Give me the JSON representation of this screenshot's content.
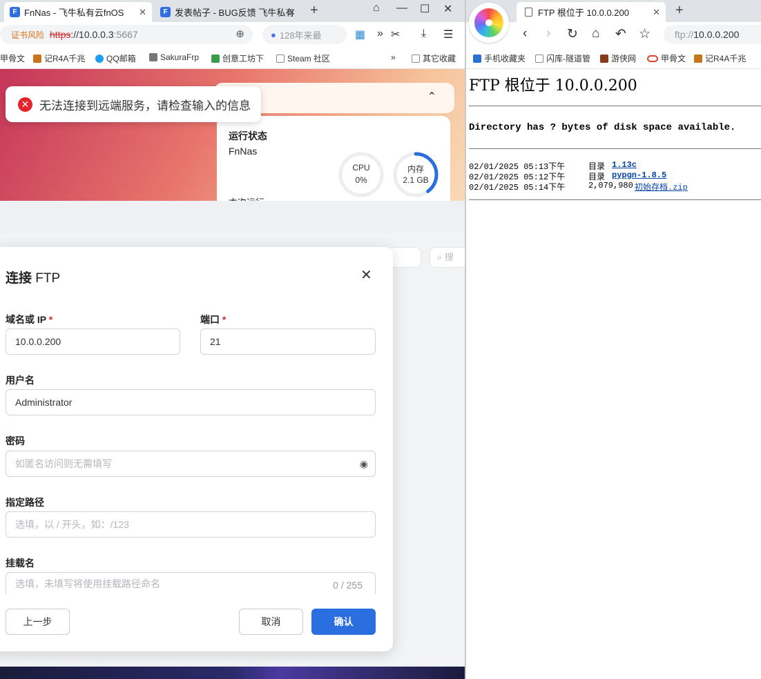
{
  "left_browser": {
    "tabs": [
      {
        "label": "FnNas - 飞牛私有云fnOS",
        "active": true
      },
      {
        "label": "发表帖子 - BUG反馈 飞牛私有",
        "active": false
      }
    ],
    "address": {
      "risk_label": "证书风险",
      "scheme": "https",
      "host": "://10.0.0.3",
      "port": ":5667"
    },
    "search_placeholder": "128年来最",
    "bookmarks": [
      "甲骨文",
      "记R4A千兆",
      "QQ邮箱",
      "SakuraFrp",
      "创意工坊下",
      "Steam 社区"
    ],
    "bookmarks_other": "其它收藏"
  },
  "page": {
    "toast": "无法连接到远端服务，请检查输入的信息",
    "status_card": {
      "title": "运行状态",
      "device": "FnNas",
      "uptime_label": "本次运行",
      "cpu": {
        "label": "CPU",
        "value": "0%",
        "fraction": 0.0
      },
      "mem": {
        "label": "内存",
        "value": "2.1 GB",
        "fraction": 0.4
      }
    },
    "search_placeholder": "搜"
  },
  "dialog": {
    "title_bold": "连接",
    "title_rest": " FTP",
    "host": {
      "label": "域名或 IP",
      "required": "*",
      "value": "10.0.0.200"
    },
    "port": {
      "label": "端口",
      "required": "*",
      "value": "21"
    },
    "username": {
      "label": "用户名",
      "value": "Administrator"
    },
    "password": {
      "label": "密码",
      "placeholder": "如匿名访问则无需填写"
    },
    "path": {
      "label": "指定路径",
      "placeholder": "选填，以 / 开头，如：/123"
    },
    "mount": {
      "label": "挂载名",
      "placeholder": "选填，未填写将使用挂载路径命名",
      "counter": "0 / 255"
    },
    "buttons": {
      "back": "上一步",
      "cancel": "取消",
      "confirm": "确认"
    }
  },
  "right_browser": {
    "tab_label": "FTP 根位于 10.0.0.200",
    "url_scheme": "ftp://",
    "url_host": "10.0.0.200",
    "bookmarks": [
      "手机收藏夹",
      "闪库-隧道管",
      "游侠网",
      "甲骨文",
      "记R4A千兆"
    ]
  },
  "ftp": {
    "heading": "FTP 根位于 10.0.0.200",
    "space": "Directory has ? bytes of disk space available.",
    "entries": [
      {
        "date": "02/01/2025 05:13下午",
        "kind": "目录",
        "name": "1.13c"
      },
      {
        "date": "02/01/2025 05:12下午",
        "kind": "目录",
        "name": "pypgn-1.8.5"
      },
      {
        "date": "02/01/2025 05:14下午",
        "size": "2,079,980",
        "name": "初始存档.zip"
      }
    ]
  },
  "colors": {
    "accent": "#2a6ee0",
    "error": "#e5242a",
    "link": "#0645ad"
  }
}
